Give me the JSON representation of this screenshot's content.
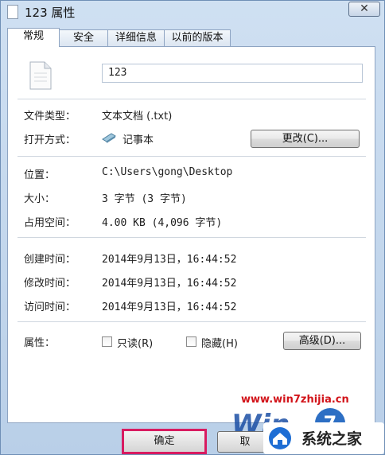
{
  "window": {
    "title": "123 属性",
    "close_glyph": "✕"
  },
  "tabs": [
    {
      "label": "常规"
    },
    {
      "label": "安全"
    },
    {
      "label": "详细信息"
    },
    {
      "label": "以前的版本"
    }
  ],
  "general": {
    "file_name": "123",
    "file_type_label": "文件类型：",
    "file_type_value": "文本文档 (.txt)",
    "opens_with_label": "打开方式：",
    "opens_with_value": "记事本",
    "change_button": "更改(C)...",
    "location_label": "位置：",
    "location_value": "C:\\Users\\gong\\Desktop",
    "size_label": "大小：",
    "size_value": "3 字节 (3 字节)",
    "size_on_disk_label": "占用空间：",
    "size_on_disk_value": "4.00 KB (4,096 字节)",
    "created_label": "创建时间：",
    "created_value": "2014年9月13日，16:44:52",
    "modified_label": "修改时间：",
    "modified_value": "2014年9月13日，16:44:52",
    "accessed_label": "访问时间：",
    "accessed_value": "2014年9月13日，16:44:52",
    "attributes_label": "属性：",
    "readonly_label": "只读(R)",
    "hidden_label": "隐藏(H)",
    "advanced_button": "高级(D)..."
  },
  "footer": {
    "ok_button": "确定",
    "cancel_button": "取"
  },
  "watermark": {
    "url": "www.win7zhijia.cn",
    "logo_text": "Win",
    "logo_digit": "7",
    "site_name": "系统之家"
  },
  "colors": {
    "highlight": "#d81b60",
    "watermark_red": "#d2141a"
  }
}
